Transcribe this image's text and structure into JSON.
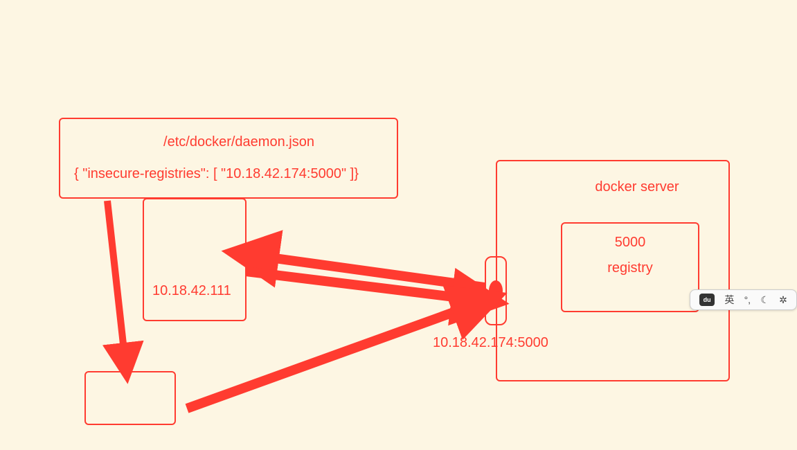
{
  "config": {
    "title": "/etc/docker/daemon.json",
    "content": "{ \"insecure-registries\": [ \"10.18.42.174:5000\" ]}"
  },
  "client1": {
    "ip": "10.18.42.111"
  },
  "server": {
    "title": "docker server",
    "registry": {
      "port": "5000",
      "name": "registry"
    },
    "endpoint": "10.18.42.174:5000"
  },
  "ime": {
    "logo": "du",
    "lang": "英",
    "punct": "°,",
    "moon": "☾",
    "gear": "✲"
  }
}
